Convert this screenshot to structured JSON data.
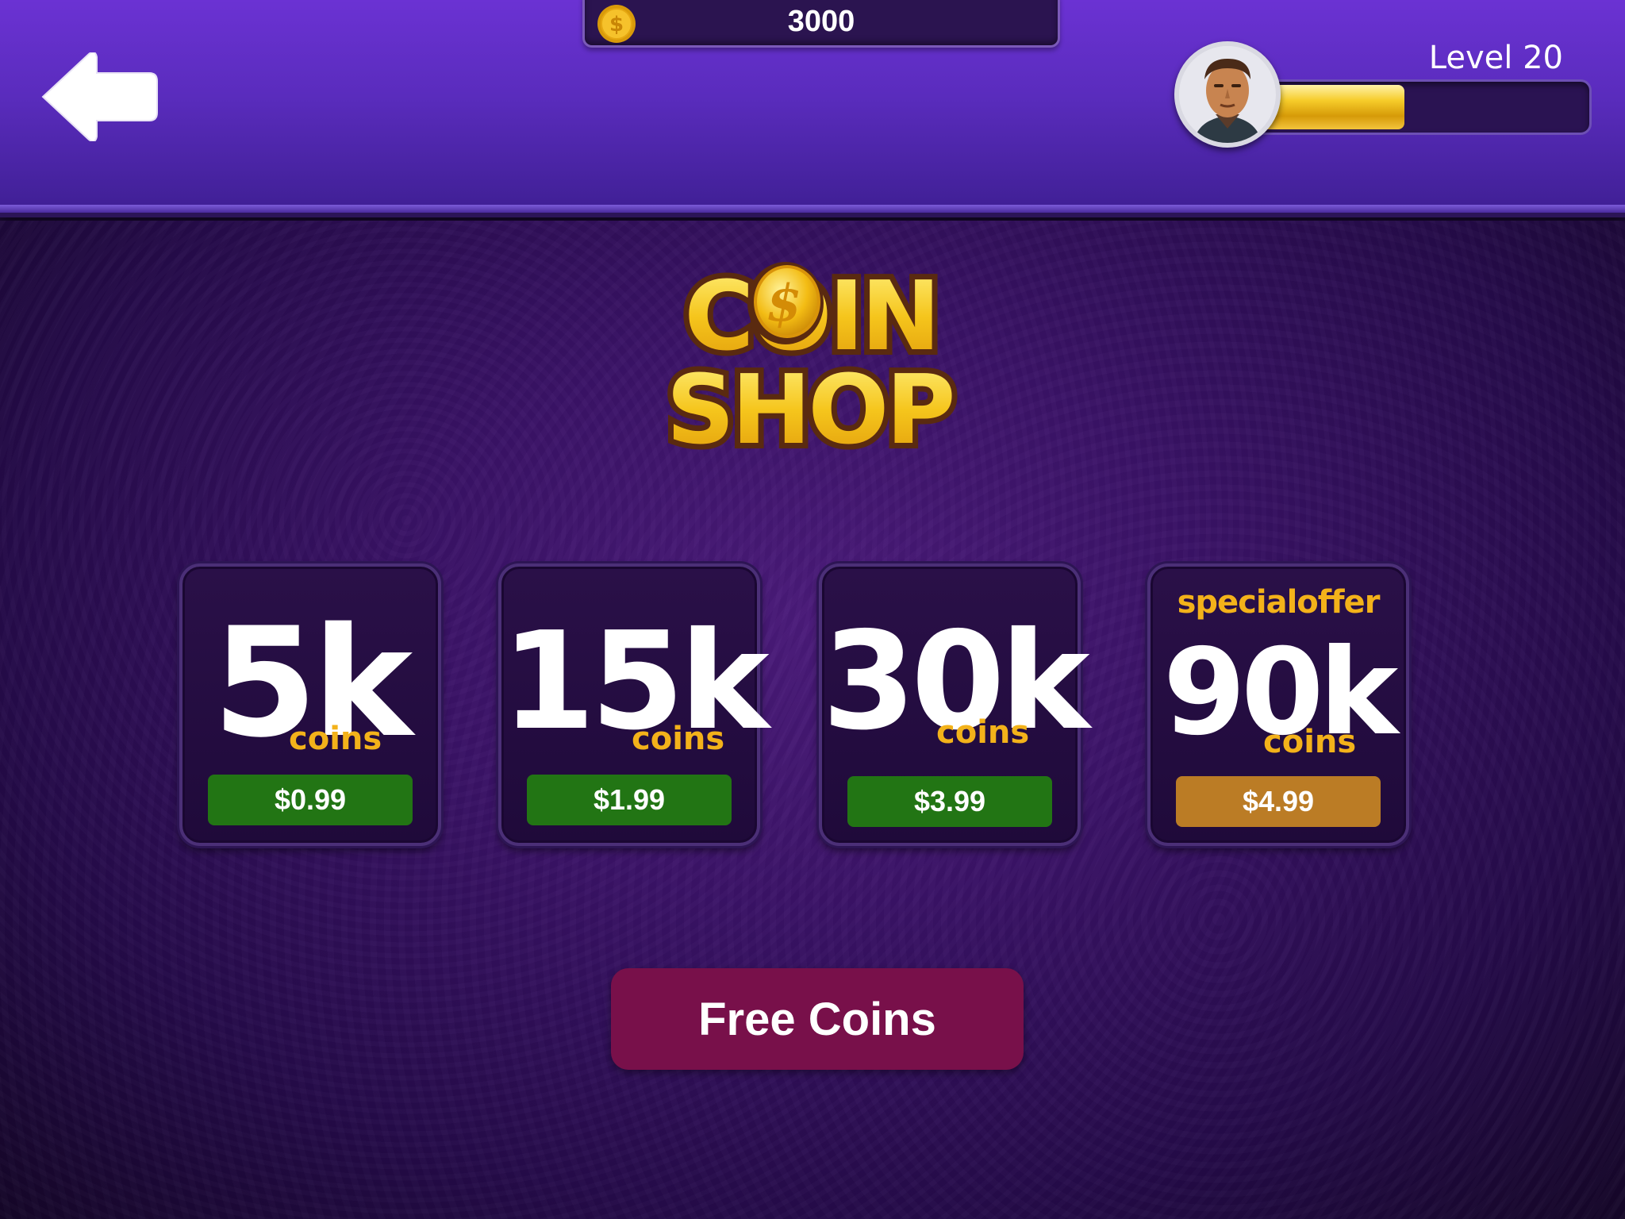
{
  "header": {
    "coin_balance": "3000",
    "level_label": "Level 20",
    "xp_progress": 0.47
  },
  "logo": {
    "line1": "COIN",
    "line2": "SHOP"
  },
  "offers": [
    {
      "amount": "5k",
      "unit": "coins",
      "price": "$0.99"
    },
    {
      "amount": "15k",
      "unit": "coins",
      "price": "$1.99"
    },
    {
      "amount": "30k",
      "unit": "coins",
      "price": "$3.99"
    },
    {
      "tag": "specialoffer",
      "amount": "90k",
      "unit": "coins",
      "price": "$4.99"
    }
  ],
  "free_coins_label": "Free Coins",
  "icons": {
    "back": "arrow-left-icon",
    "coin": "dollar-coin-icon",
    "avatar": "player-avatar"
  },
  "colors": {
    "header": "#5a2cbd",
    "price_button": "#227514",
    "special_price_button": "#bb7c25",
    "free_coins_button": "#78104a",
    "accent_gold": "#f3b21a"
  }
}
